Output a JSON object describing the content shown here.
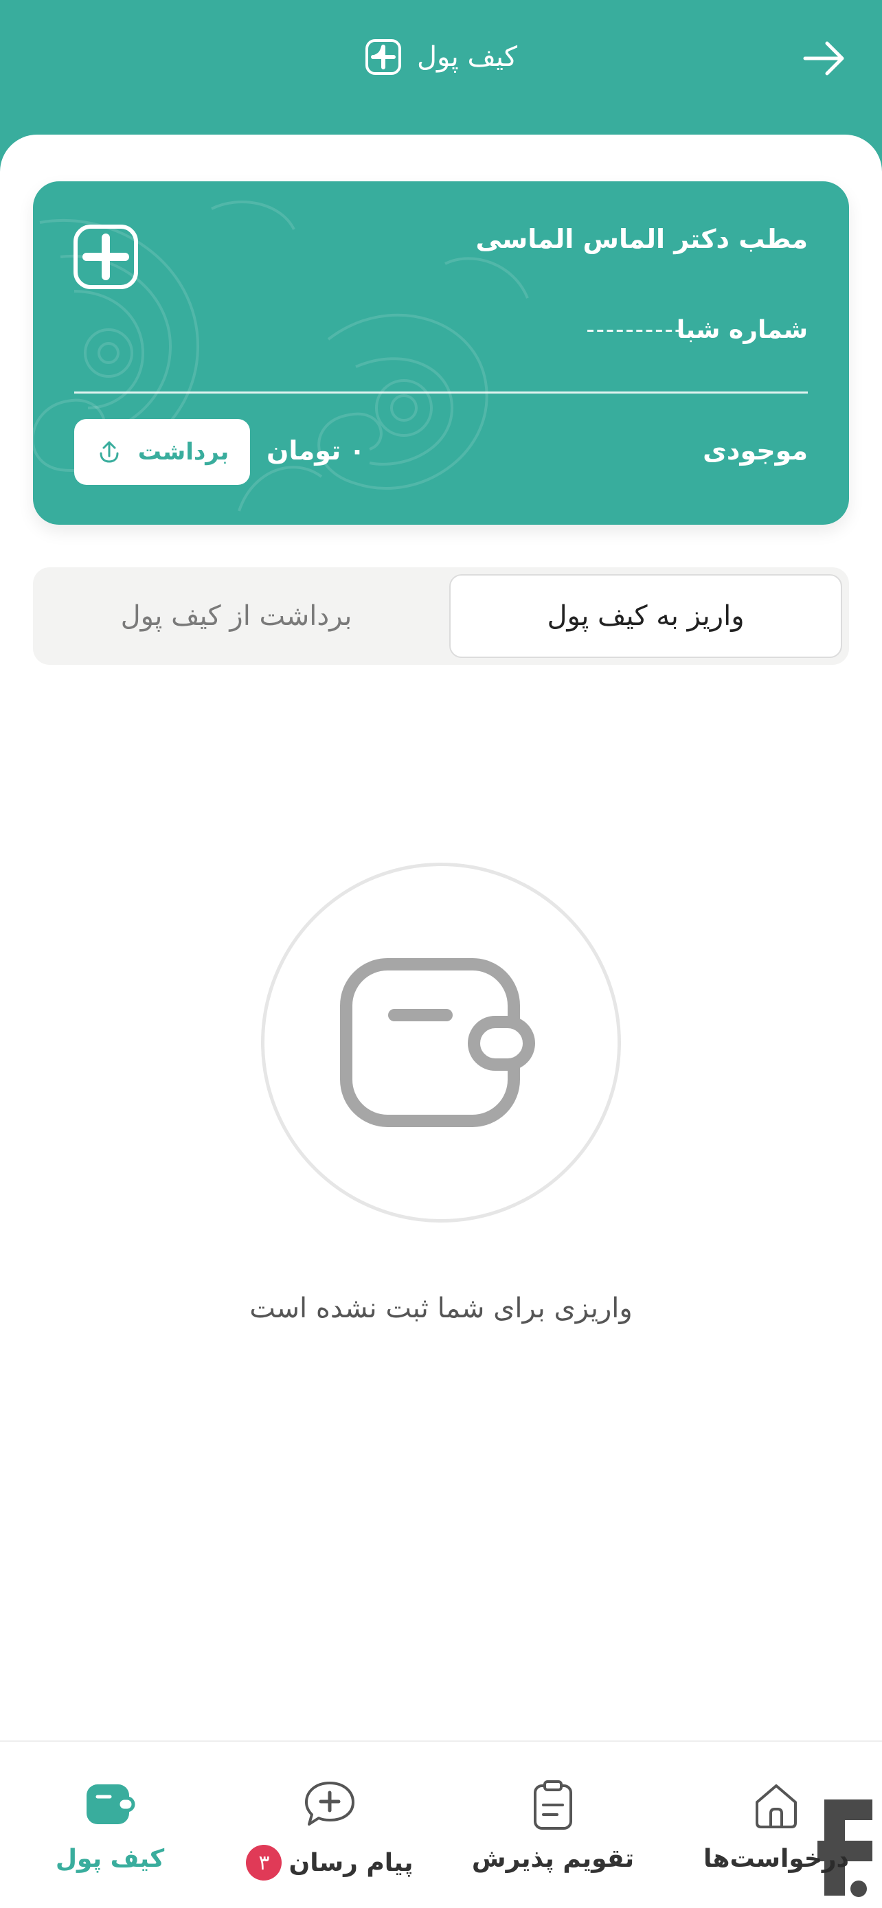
{
  "colors": {
    "primary": "#39ad9d",
    "badge": "#e03a57",
    "muted": "#7a7a7a"
  },
  "header": {
    "title": "کیف پول",
    "back_icon": "arrow-right-icon",
    "logo_icon": "plus-square-icon"
  },
  "card": {
    "clinic_name": "مطب دکتر الماس الماسی",
    "sheba_label": "شماره شبا",
    "sheba_value": "----------",
    "balance_label": "موجودی",
    "balance_amount": "۰",
    "balance_unit": "تومان",
    "withdraw_label": "برداشت",
    "withdraw_icon": "upload-icon"
  },
  "tabs": [
    {
      "label": "واریز به کیف پول",
      "active": true
    },
    {
      "label": "برداشت از کیف پول",
      "active": false
    }
  ],
  "empty_state": {
    "icon": "wallet-icon",
    "text": "واریزی برای شما ثبت نشده است"
  },
  "nav": [
    {
      "label": "کیف پول",
      "icon": "wallet-icon",
      "active": true
    },
    {
      "label": "پیام رسان",
      "icon": "chat-plus-icon",
      "badge": "۳"
    },
    {
      "label": "تقویم پذیرش",
      "icon": "clipboard-icon"
    },
    {
      "label": "درخواست‌ها",
      "icon": "home-icon"
    }
  ]
}
